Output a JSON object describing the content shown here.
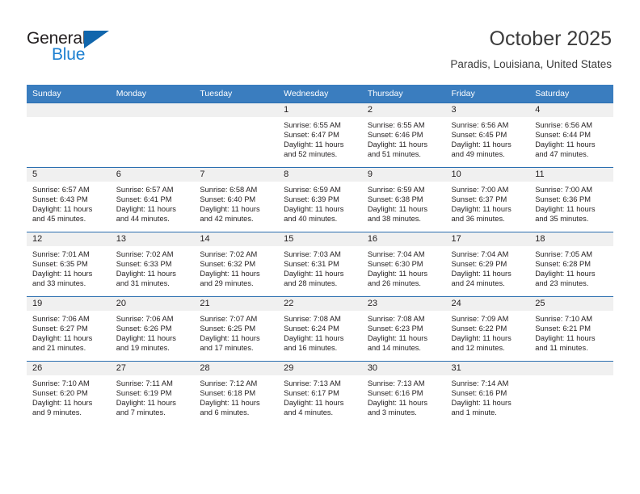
{
  "brand": {
    "name_line1": "General",
    "name_line2": "Blue"
  },
  "header": {
    "title": "October 2025",
    "location": "Paradis, Louisiana, United States"
  },
  "colors": {
    "header_blue": "#3a7dbf",
    "row_divider": "#2c6fb0",
    "daynum_strip": "#f0f0f0",
    "brand_blue": "#1c7fd0",
    "brand_triangle": "#1166ac",
    "text": "#231f20"
  },
  "calendar": {
    "weekday_headers": [
      "Sunday",
      "Monday",
      "Tuesday",
      "Wednesday",
      "Thursday",
      "Friday",
      "Saturday"
    ],
    "weeks": [
      [
        {
          "day": "",
          "empty": true
        },
        {
          "day": "",
          "empty": true
        },
        {
          "day": "",
          "empty": true
        },
        {
          "day": "1",
          "sunrise": "Sunrise: 6:55 AM",
          "sunset": "Sunset: 6:47 PM",
          "daylight1": "Daylight: 11 hours",
          "daylight2": "and 52 minutes."
        },
        {
          "day": "2",
          "sunrise": "Sunrise: 6:55 AM",
          "sunset": "Sunset: 6:46 PM",
          "daylight1": "Daylight: 11 hours",
          "daylight2": "and 51 minutes."
        },
        {
          "day": "3",
          "sunrise": "Sunrise: 6:56 AM",
          "sunset": "Sunset: 6:45 PM",
          "daylight1": "Daylight: 11 hours",
          "daylight2": "and 49 minutes."
        },
        {
          "day": "4",
          "sunrise": "Sunrise: 6:56 AM",
          "sunset": "Sunset: 6:44 PM",
          "daylight1": "Daylight: 11 hours",
          "daylight2": "and 47 minutes."
        }
      ],
      [
        {
          "day": "5",
          "sunrise": "Sunrise: 6:57 AM",
          "sunset": "Sunset: 6:43 PM",
          "daylight1": "Daylight: 11 hours",
          "daylight2": "and 45 minutes."
        },
        {
          "day": "6",
          "sunrise": "Sunrise: 6:57 AM",
          "sunset": "Sunset: 6:41 PM",
          "daylight1": "Daylight: 11 hours",
          "daylight2": "and 44 minutes."
        },
        {
          "day": "7",
          "sunrise": "Sunrise: 6:58 AM",
          "sunset": "Sunset: 6:40 PM",
          "daylight1": "Daylight: 11 hours",
          "daylight2": "and 42 minutes."
        },
        {
          "day": "8",
          "sunrise": "Sunrise: 6:59 AM",
          "sunset": "Sunset: 6:39 PM",
          "daylight1": "Daylight: 11 hours",
          "daylight2": "and 40 minutes."
        },
        {
          "day": "9",
          "sunrise": "Sunrise: 6:59 AM",
          "sunset": "Sunset: 6:38 PM",
          "daylight1": "Daylight: 11 hours",
          "daylight2": "and 38 minutes."
        },
        {
          "day": "10",
          "sunrise": "Sunrise: 7:00 AM",
          "sunset": "Sunset: 6:37 PM",
          "daylight1": "Daylight: 11 hours",
          "daylight2": "and 36 minutes."
        },
        {
          "day": "11",
          "sunrise": "Sunrise: 7:00 AM",
          "sunset": "Sunset: 6:36 PM",
          "daylight1": "Daylight: 11 hours",
          "daylight2": "and 35 minutes."
        }
      ],
      [
        {
          "day": "12",
          "sunrise": "Sunrise: 7:01 AM",
          "sunset": "Sunset: 6:35 PM",
          "daylight1": "Daylight: 11 hours",
          "daylight2": "and 33 minutes."
        },
        {
          "day": "13",
          "sunrise": "Sunrise: 7:02 AM",
          "sunset": "Sunset: 6:33 PM",
          "daylight1": "Daylight: 11 hours",
          "daylight2": "and 31 minutes."
        },
        {
          "day": "14",
          "sunrise": "Sunrise: 7:02 AM",
          "sunset": "Sunset: 6:32 PM",
          "daylight1": "Daylight: 11 hours",
          "daylight2": "and 29 minutes."
        },
        {
          "day": "15",
          "sunrise": "Sunrise: 7:03 AM",
          "sunset": "Sunset: 6:31 PM",
          "daylight1": "Daylight: 11 hours",
          "daylight2": "and 28 minutes."
        },
        {
          "day": "16",
          "sunrise": "Sunrise: 7:04 AM",
          "sunset": "Sunset: 6:30 PM",
          "daylight1": "Daylight: 11 hours",
          "daylight2": "and 26 minutes."
        },
        {
          "day": "17",
          "sunrise": "Sunrise: 7:04 AM",
          "sunset": "Sunset: 6:29 PM",
          "daylight1": "Daylight: 11 hours",
          "daylight2": "and 24 minutes."
        },
        {
          "day": "18",
          "sunrise": "Sunrise: 7:05 AM",
          "sunset": "Sunset: 6:28 PM",
          "daylight1": "Daylight: 11 hours",
          "daylight2": "and 23 minutes."
        }
      ],
      [
        {
          "day": "19",
          "sunrise": "Sunrise: 7:06 AM",
          "sunset": "Sunset: 6:27 PM",
          "daylight1": "Daylight: 11 hours",
          "daylight2": "and 21 minutes."
        },
        {
          "day": "20",
          "sunrise": "Sunrise: 7:06 AM",
          "sunset": "Sunset: 6:26 PM",
          "daylight1": "Daylight: 11 hours",
          "daylight2": "and 19 minutes."
        },
        {
          "day": "21",
          "sunrise": "Sunrise: 7:07 AM",
          "sunset": "Sunset: 6:25 PM",
          "daylight1": "Daylight: 11 hours",
          "daylight2": "and 17 minutes."
        },
        {
          "day": "22",
          "sunrise": "Sunrise: 7:08 AM",
          "sunset": "Sunset: 6:24 PM",
          "daylight1": "Daylight: 11 hours",
          "daylight2": "and 16 minutes."
        },
        {
          "day": "23",
          "sunrise": "Sunrise: 7:08 AM",
          "sunset": "Sunset: 6:23 PM",
          "daylight1": "Daylight: 11 hours",
          "daylight2": "and 14 minutes."
        },
        {
          "day": "24",
          "sunrise": "Sunrise: 7:09 AM",
          "sunset": "Sunset: 6:22 PM",
          "daylight1": "Daylight: 11 hours",
          "daylight2": "and 12 minutes."
        },
        {
          "day": "25",
          "sunrise": "Sunrise: 7:10 AM",
          "sunset": "Sunset: 6:21 PM",
          "daylight1": "Daylight: 11 hours",
          "daylight2": "and 11 minutes."
        }
      ],
      [
        {
          "day": "26",
          "sunrise": "Sunrise: 7:10 AM",
          "sunset": "Sunset: 6:20 PM",
          "daylight1": "Daylight: 11 hours",
          "daylight2": "and 9 minutes."
        },
        {
          "day": "27",
          "sunrise": "Sunrise: 7:11 AM",
          "sunset": "Sunset: 6:19 PM",
          "daylight1": "Daylight: 11 hours",
          "daylight2": "and 7 minutes."
        },
        {
          "day": "28",
          "sunrise": "Sunrise: 7:12 AM",
          "sunset": "Sunset: 6:18 PM",
          "daylight1": "Daylight: 11 hours",
          "daylight2": "and 6 minutes."
        },
        {
          "day": "29",
          "sunrise": "Sunrise: 7:13 AM",
          "sunset": "Sunset: 6:17 PM",
          "daylight1": "Daylight: 11 hours",
          "daylight2": "and 4 minutes."
        },
        {
          "day": "30",
          "sunrise": "Sunrise: 7:13 AM",
          "sunset": "Sunset: 6:16 PM",
          "daylight1": "Daylight: 11 hours",
          "daylight2": "and 3 minutes."
        },
        {
          "day": "31",
          "sunrise": "Sunrise: 7:14 AM",
          "sunset": "Sunset: 6:16 PM",
          "daylight1": "Daylight: 11 hours",
          "daylight2": "and 1 minute."
        },
        {
          "day": "",
          "empty": true
        }
      ]
    ]
  }
}
